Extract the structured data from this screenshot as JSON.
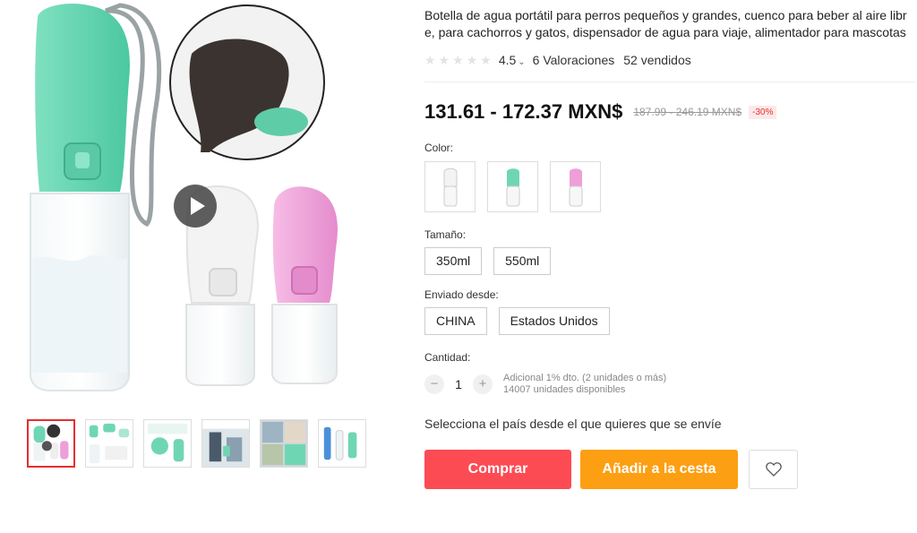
{
  "product": {
    "title": "Botella de agua portátil para perros pequeños y grandes, cuenco para beber al aire libre, para cachorros y gatos, dispensador de agua para viaje, alimentador para mascotas",
    "rating": "4.5",
    "rating_chevron": "⌄",
    "reviews": "6 Valoraciones",
    "sold": "52 vendidos",
    "stars": [
      "★",
      "★",
      "★",
      "★",
      "★"
    ]
  },
  "pricing": {
    "price": "131.61 - 172.37 MXN$",
    "old_price": "187.99 - 246.19 MXN$",
    "discount": "-30%"
  },
  "options": {
    "color_label": "Color:",
    "colors": [
      "#ffffff",
      "#6fd6b4",
      "#ee9fd8"
    ],
    "size_label": "Tamaño:",
    "sizes": [
      "350ml",
      "550ml"
    ],
    "ship_label": "Enviado desde:",
    "ship_from": [
      "CHINA",
      "Estados Unidos"
    ]
  },
  "quantity": {
    "label": "Cantidad:",
    "minus": "−",
    "plus": "+",
    "value": "1",
    "note_line1": "Adicional 1% dto. (2 unidades o más)",
    "note_line2": "14007 unidades disponibles"
  },
  "shipping_message": "Selecciona el país desde el que quieres que se envíe",
  "actions": {
    "buy": "Comprar",
    "add_to_cart": "Añadir a la cesta",
    "wishlist_icon": "heart-icon"
  },
  "gallery": {
    "thumb_count": 6,
    "active_thumb": 0,
    "icons": [
      "play-icon"
    ]
  }
}
